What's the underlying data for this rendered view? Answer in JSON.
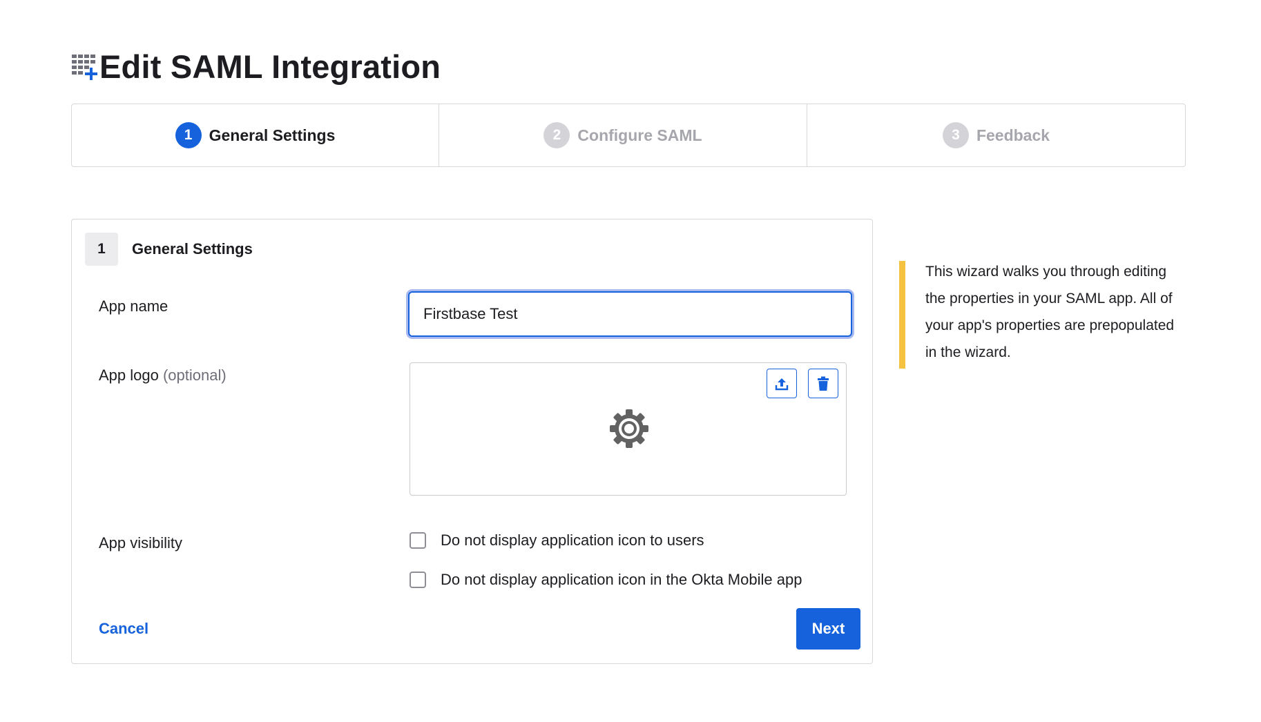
{
  "page": {
    "title": "Edit SAML Integration",
    "title_icon": "app-grid-plus-icon"
  },
  "steps": [
    {
      "number": "1",
      "label": "General Settings",
      "state": "active"
    },
    {
      "number": "2",
      "label": "Configure SAML",
      "state": "inactive"
    },
    {
      "number": "3",
      "label": "Feedback",
      "state": "inactive"
    }
  ],
  "section": {
    "number": "1",
    "title": "General Settings"
  },
  "form": {
    "app_name_label": "App name",
    "app_name_value": "Firstbase Test",
    "app_logo_label": "App logo",
    "app_logo_optional": "(optional)",
    "app_visibility_label": "App visibility",
    "visibility_options": [
      {
        "label": "Do not display application icon to users",
        "checked": false
      },
      {
        "label": "Do not display application icon in the Okta Mobile app",
        "checked": false
      }
    ]
  },
  "actions": {
    "cancel_label": "Cancel",
    "next_label": "Next"
  },
  "callout": {
    "text": "This wizard walks you through editing the properties in your SAML app. All of your app's properties are prepopulated in the wizard."
  },
  "colors": {
    "accent": "#1662dd",
    "callout_bar": "#f5c242",
    "inactive_step": "#a6a6ad"
  }
}
